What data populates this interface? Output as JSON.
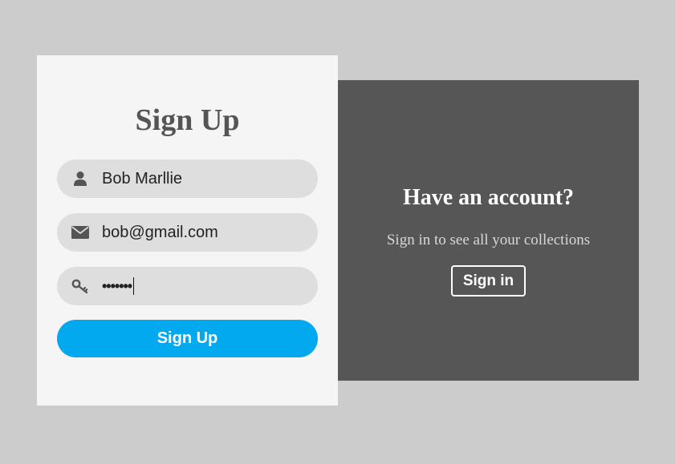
{
  "signup": {
    "title": "Sign Up",
    "name_field": {
      "value": "Bob Marllie",
      "icon": "user-icon"
    },
    "email_field": {
      "value": "bob@gmail.com",
      "icon": "envelope-icon"
    },
    "password_field": {
      "value": "•••••••",
      "icon": "key-icon"
    },
    "button_label": "Sign Up"
  },
  "signin": {
    "heading": "Have an account?",
    "subtitle": "Sign in to see all your collections",
    "button_label": "Sign in"
  },
  "colors": {
    "background": "#cccccc",
    "card": "#f5f5f5",
    "field": "#dedede",
    "accent": "#03a9ee",
    "panel": "#565656"
  }
}
